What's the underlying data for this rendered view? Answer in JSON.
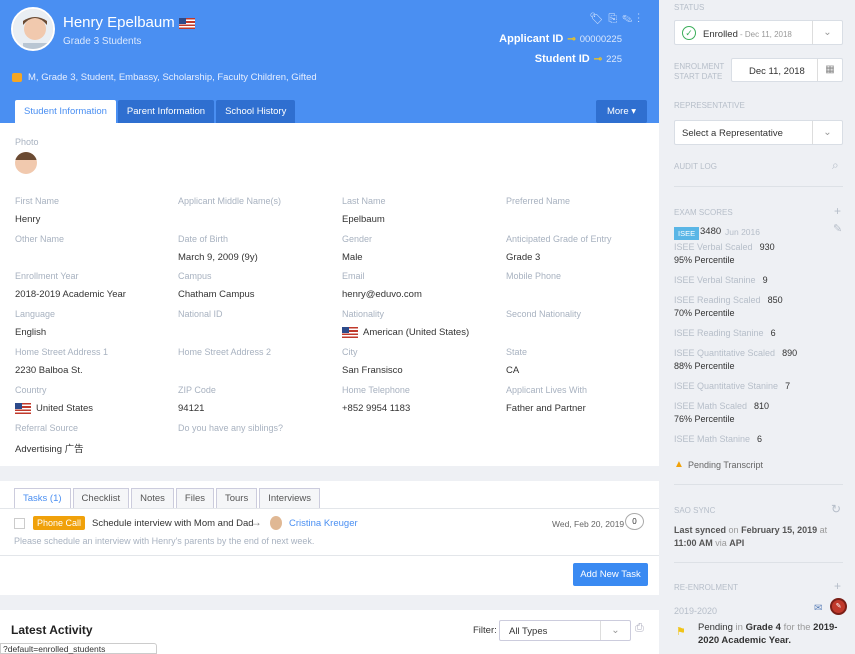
{
  "header": {
    "name": "Henry Epelbaum",
    "subtitle": "Grade 3 Students",
    "tags": "M, Grade 3, Student, Embassy, Scholarship, Faculty Children, Gifted",
    "applicant_label": "Applicant ID",
    "applicant_id": "00000225",
    "student_label": "Student ID",
    "student_id": "225",
    "accent": "#4a8ff2"
  },
  "tabs": [
    "Student Information",
    "Parent Information",
    "School History"
  ],
  "more": "More",
  "photo_label": "Photo",
  "fields": [
    {
      "label": "First Name",
      "value": "Henry"
    },
    {
      "label": "Applicant Middle Name(s)",
      "value": ""
    },
    {
      "label": "Last Name",
      "value": "Epelbaum"
    },
    {
      "label": "Preferred Name",
      "value": ""
    },
    {
      "label": "Other Name",
      "value": ""
    },
    {
      "label": "Date of Birth",
      "value": "March 9, 2009 (9y)"
    },
    {
      "label": "Gender",
      "value": "Male"
    },
    {
      "label": "Anticipated Grade of Entry",
      "value": "Grade 3"
    },
    {
      "label": "Enrollment Year",
      "value": "2018-2019 Academic Year"
    },
    {
      "label": "Campus",
      "value": "Chatham Campus"
    },
    {
      "label": "Email",
      "value": "henry@eduvo.com"
    },
    {
      "label": "Mobile Phone",
      "value": ""
    },
    {
      "label": "Language",
      "value": "English"
    },
    {
      "label": "National ID",
      "value": ""
    },
    {
      "label": "Nationality",
      "value": "American (United States)"
    },
    {
      "label": "Second Nationality",
      "value": ""
    },
    {
      "label": "Home Street Address 1",
      "value": "2230 Balboa St."
    },
    {
      "label": "Home Street Address 2",
      "value": ""
    },
    {
      "label": "City",
      "value": "San Fransisco"
    },
    {
      "label": "State",
      "value": "CA"
    },
    {
      "label": "Country",
      "value": "United States"
    },
    {
      "label": "ZIP Code",
      "value": "94121"
    },
    {
      "label": "Home Telephone",
      "value": "+852 9954 1183"
    },
    {
      "label": "Applicant Lives With",
      "value": "Father and Partner"
    },
    {
      "label": "Referral Source",
      "value": "Advertising 广告"
    },
    {
      "label": "Do you have any siblings?",
      "value": ""
    }
  ],
  "task_tabs": [
    "Tasks (1)",
    "Checklist",
    "Notes",
    "Files",
    "Tours",
    "Interviews"
  ],
  "task": {
    "badge": "Phone Call",
    "title": "Schedule interview with Mom and Dad",
    "assignee": "Cristina Kreuger",
    "date": "Wed, Feb 20, 2019",
    "count": "0",
    "desc": "Please schedule an interview with Henry's parents by the end of next week."
  },
  "add_task": "Add New Task",
  "activity": {
    "title": "Latest Activity",
    "filter_label": "Filter:",
    "filter_value": "All Types"
  },
  "status_url": "?default=enrolled_students",
  "side": {
    "status_label": "STATUS",
    "status_value": "Enrolled",
    "status_date": "- Dec 11, 2018",
    "enrol_label1": "ENROLMENT",
    "enrol_label2": "START DATE",
    "enrol_date": "Dec 11, 2018",
    "rep_label": "REPRESENTATIVE",
    "rep_value": "Select a Representative",
    "audit": "AUDIT LOG",
    "exam_label": "EXAM SCORES",
    "isee_tag": "ISEE",
    "isee_score": "3480",
    "isee_date": "Jun 2016",
    "scores": [
      {
        "name": "ISEE Verbal Scaled",
        "val": "930",
        "pct": "95% Percentile"
      },
      {
        "name": "ISEE Verbal Stanine",
        "val": "9",
        "pct": ""
      },
      {
        "name": "ISEE Reading Scaled",
        "val": "850",
        "pct": "70% Percentile"
      },
      {
        "name": "ISEE Reading Stanine",
        "val": "6",
        "pct": ""
      },
      {
        "name": "ISEE Quantitative Scaled",
        "val": "890",
        "pct": "88% Percentile"
      },
      {
        "name": "ISEE Quantitative Stanine",
        "val": "7",
        "pct": ""
      },
      {
        "name": "ISEE Math Scaled",
        "val": "810",
        "pct": "76% Percentile"
      },
      {
        "name": "ISEE Math Stanine",
        "val": "6",
        "pct": ""
      }
    ],
    "pending_transcript": "Pending Transcript",
    "sao_label": "SAO SYNC",
    "last_synced": "Last synced",
    "on": "on",
    "synced_date": "February 15, 2019",
    "at": "at",
    "synced_time": "11:00 AM",
    "via": "via",
    "api": "API",
    "reenrol_label": "RE-ENROLMENT",
    "reenrol_year": "2019-2020",
    "pending": "Pending",
    "in": "in",
    "grade": "Grade 4",
    "for_the": "for the",
    "year": "2019-2020 Academic Year."
  }
}
